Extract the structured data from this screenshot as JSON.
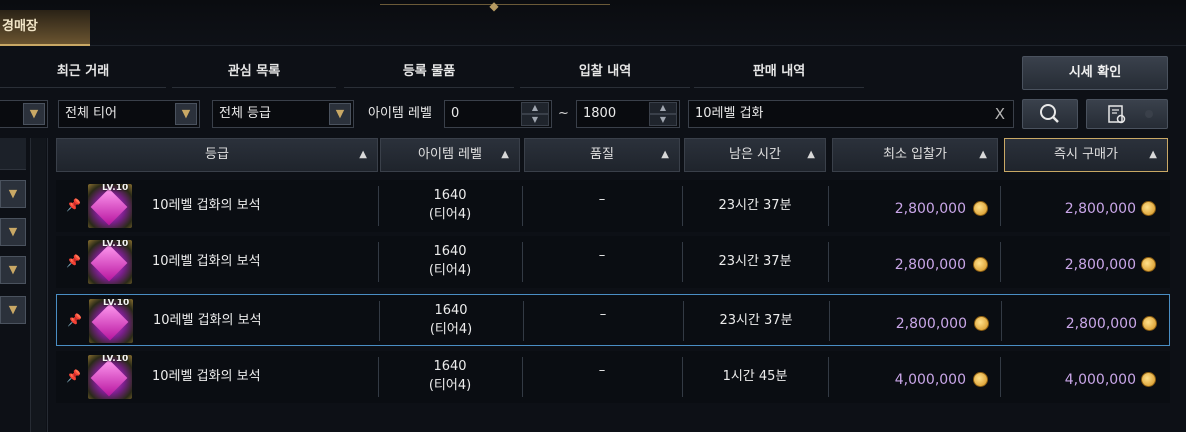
{
  "window": {
    "title": "경매장"
  },
  "tabs": [
    "최근 거래",
    "관심 목록",
    "등록 물품",
    "입찰 내역",
    "판매 내역"
  ],
  "price_check_label": "시세 확인",
  "filters": {
    "tier": "전체 티어",
    "grade": "전체 등급",
    "item_level_label": "아이템 레벨",
    "level_min": "0",
    "range_sep": "~",
    "level_max": "1800",
    "search_text": "10레벨 겁화",
    "clear_icon": "X"
  },
  "columns": [
    "등급",
    "아이템 레벨",
    "품질",
    "남은 시간",
    "최소 입찰가",
    "즉시 구매가"
  ],
  "sort_glyph": "▲",
  "rows": [
    {
      "badge": "LV.10",
      "name": "10레벨 겁화의 보석",
      "level": "1640",
      "tier": "(티어4)",
      "quality": "–",
      "time": "23시간 37분",
      "min_bid": "2,800,000",
      "buyout": "2,800,000",
      "selected": false
    },
    {
      "badge": "LV.10",
      "name": "10레벨 겁화의 보석",
      "level": "1640",
      "tier": "(티어4)",
      "quality": "–",
      "time": "23시간 37분",
      "min_bid": "2,800,000",
      "buyout": "2,800,000",
      "selected": false
    },
    {
      "badge": "LV.10",
      "name": "10레벨 겁화의 보석",
      "level": "1640",
      "tier": "(티어4)",
      "quality": "–",
      "time": "23시간 37분",
      "min_bid": "2,800,000",
      "buyout": "2,800,000",
      "selected": true
    },
    {
      "badge": "LV.10",
      "name": "10레벨 겁화의 보석",
      "level": "1640",
      "tier": "(티어4)",
      "quality": "–",
      "time": "1시간 45분",
      "min_bid": "4,000,000",
      "buyout": "4,000,000",
      "selected": false
    }
  ],
  "colors": {
    "accent_gold": "#c9a865",
    "price_purple": "#c9a6e8",
    "selection_blue": "#4a8ec4"
  }
}
